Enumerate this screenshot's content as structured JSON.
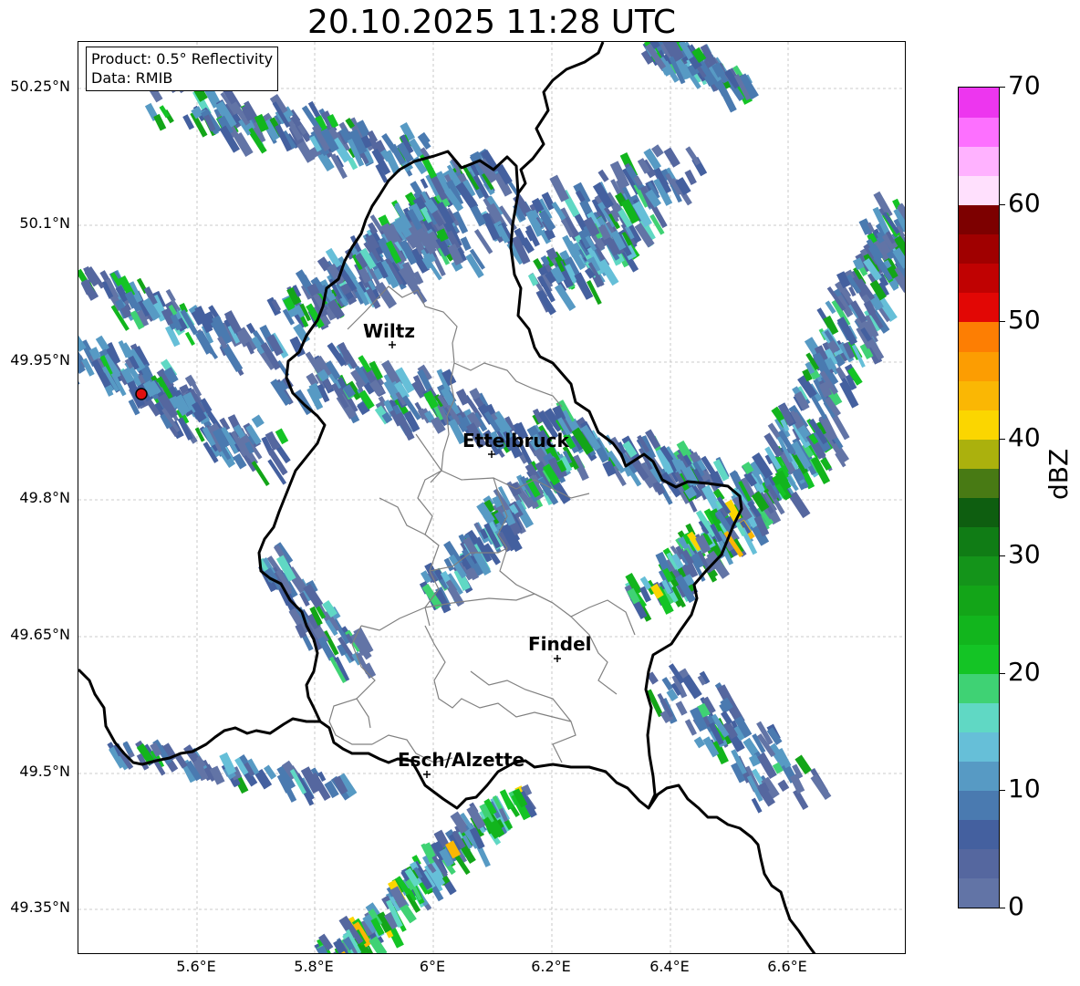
{
  "title": "20.10.2025 11:28 UTC",
  "info": {
    "product": "Product: 0.5° Reflectivity",
    "data": "Data: RMIB"
  },
  "axes": {
    "lat_labels": [
      "50.25°N",
      "50.1°N",
      "49.95°N",
      "49.8°N",
      "49.65°N",
      "49.5°N",
      "49.35°N"
    ],
    "lon_labels": [
      "5.6°E",
      "5.8°E",
      "6°E",
      "6.2°E",
      "6.4°E",
      "6.6°E"
    ]
  },
  "cities": [
    {
      "name": "Wiltz"
    },
    {
      "name": "Ettelbruck"
    },
    {
      "name": "Findel"
    },
    {
      "name": "Esch/Alzette"
    }
  ],
  "colorbar": {
    "unit": "dBZ",
    "tick_labels": [
      "0",
      "10",
      "20",
      "30",
      "40",
      "50",
      "60",
      "70"
    ],
    "colors": [
      "#6274a6",
      "#55679f",
      "#44609f",
      "#4a7ab0",
      "#579ac4",
      "#66bfd8",
      "#60d8c4",
      "#3fd274",
      "#14c425",
      "#12b51d",
      "#13a518",
      "#14941a",
      "#107c15",
      "#0e5e10",
      "#487a14",
      "#abb10d",
      "#fbd600",
      "#fab704",
      "#fc9d02",
      "#fd7e03",
      "#e20705",
      "#c00202",
      "#a00000",
      "#7d0000",
      "#ffe0fd",
      "#ffb2ff",
      "#fd70ff",
      "#ed36ef"
    ]
  },
  "radar_site_color": "#e01010"
}
